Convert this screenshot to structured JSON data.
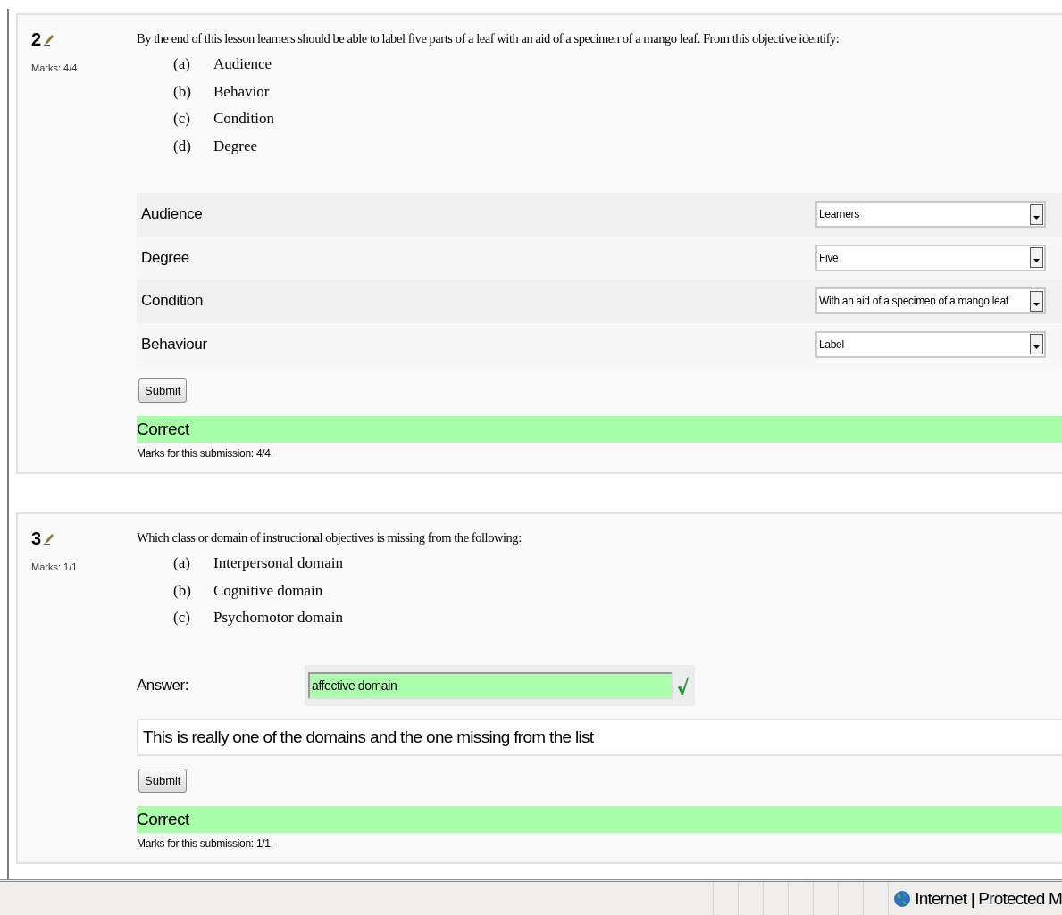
{
  "questions": [
    {
      "number": "2",
      "marks": "Marks: 4/4",
      "text": "By the end of this lesson learners should be able to label five parts of a leaf with an aid of a specimen of a mango leaf. From this objective identify:",
      "options": [
        {
          "letter": "(a)",
          "text": "Audience"
        },
        {
          "letter": "(b)",
          "text": "Behavior"
        },
        {
          "letter": "(c)",
          "text": "Condition"
        },
        {
          "letter": "(d)",
          "text": "Degree"
        }
      ],
      "kind": "matching",
      "matches": [
        {
          "label": "Audience",
          "value": "Learners"
        },
        {
          "label": "Degree",
          "value": "Five"
        },
        {
          "label": "Condition",
          "value": "With an aid of a specimen of a mango leaf"
        },
        {
          "label": "Behaviour",
          "value": "Label"
        }
      ],
      "submit": "Submit",
      "result": {
        "text": "Correct",
        "correct": true
      },
      "submission_marks": "Marks for this submission: 4/4."
    },
    {
      "number": "3",
      "marks": "Marks: 1/1",
      "text": "Which class or domain of instructional objectives is missing from the following:",
      "options": [
        {
          "letter": "(a)",
          "text": "Interpersonal domain"
        },
        {
          "letter": "(b)",
          "text": "Cognitive domain"
        },
        {
          "letter": "(c)",
          "text": "Psychomotor domain"
        }
      ],
      "kind": "shortanswer",
      "answer": {
        "label": "Answer:",
        "value": "affective domain",
        "correct": true
      },
      "feedback": "This is really one of the domains and the one missing from the list",
      "submit": "Submit",
      "result": {
        "text": "Correct",
        "correct": true
      },
      "submission_marks": "Marks for this submission: 1/1."
    }
  ],
  "status_bar": {
    "zone": "Internet | Protected M"
  }
}
